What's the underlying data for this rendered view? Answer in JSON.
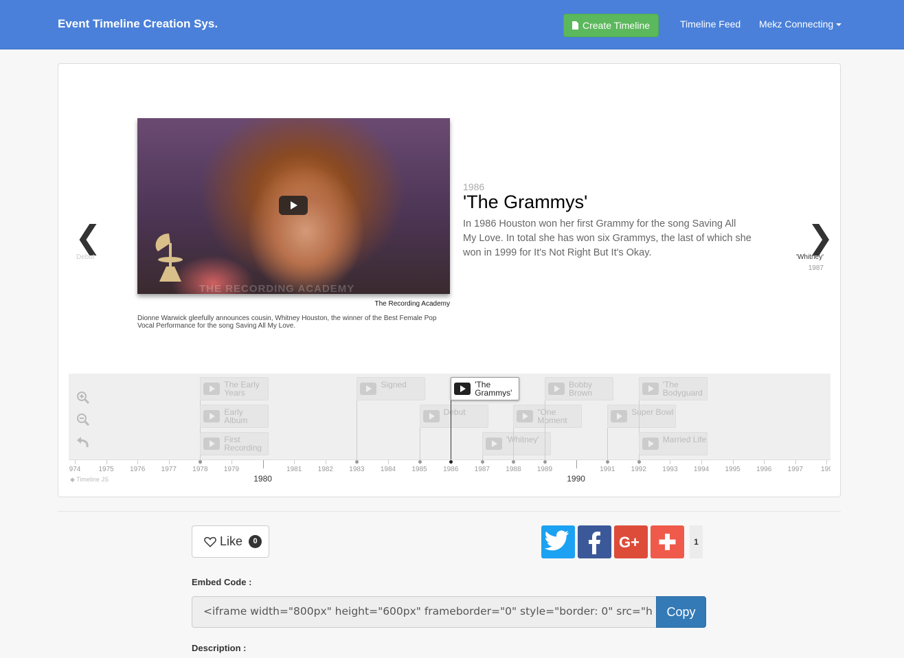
{
  "navbar": {
    "brand": "Event Timeline Creation Sys.",
    "create_label": "Create Timeline",
    "feed_label": "Timeline Feed",
    "user_label": "Mekz Connecting"
  },
  "slide": {
    "date": "1986",
    "title": "'The Grammys'",
    "text": "In 1986 Houston won her first Grammy for the song Saving All My Love. In total she has won six Grammys, the last of which she won in 1999 for It's Not Right But It's Okay.",
    "credit": "The Recording Academy",
    "caption": "Dionne Warwick gleefully announces cousin, Whitney Houston, the winner of the Best Female Pop Vocal Performance for the song Saving All My Love.",
    "watermark": "THE RECORDING ACADEMY"
  },
  "nav": {
    "prev_label": "Debut",
    "next_label": "'Whitney'",
    "next_date": "1987"
  },
  "timeline": {
    "markers": [
      {
        "label": "The Early Years",
        "year": 1978,
        "row": 0,
        "active": false
      },
      {
        "label": "Early Album",
        "year": 1978,
        "row": 1,
        "active": false
      },
      {
        "label": "First Recording",
        "year": 1978,
        "row": 2,
        "active": false
      },
      {
        "label": "Signed",
        "year": 1983,
        "row": 0,
        "active": false
      },
      {
        "label": "Debut",
        "year": 1985,
        "row": 1,
        "active": false
      },
      {
        "label": "'The Grammys'",
        "year": 1986,
        "row": 0,
        "active": true
      },
      {
        "label": "'Whitney'",
        "year": 1987,
        "row": 2,
        "active": false
      },
      {
        "label": "\"One Moment",
        "year": 1988,
        "row": 1,
        "active": false
      },
      {
        "label": "Bobby Brown",
        "year": 1989,
        "row": 0,
        "active": false
      },
      {
        "label": "Super Bowl",
        "year": 1991,
        "row": 1,
        "active": false
      },
      {
        "label": "'The Bodyguard",
        "year": 1992,
        "row": 0,
        "active": false
      },
      {
        "label": "Married Life",
        "year": 1992,
        "row": 2,
        "active": false
      }
    ],
    "years": [
      "974",
      "1975",
      "1976",
      "1977",
      "1978",
      "1979",
      "1980",
      "1981",
      "1982",
      "1983",
      "1984",
      "1985",
      "1986",
      "1987",
      "1988",
      "1989",
      "1990",
      "1991",
      "1992",
      "1993",
      "1994",
      "1995",
      "1996",
      "1997",
      "199"
    ],
    "major_years": [
      "1980",
      "1990"
    ],
    "brand": "Timeline JS",
    "tools": [
      "zoom-in-icon",
      "zoom-out-icon",
      "back-to-start-icon"
    ]
  },
  "like": {
    "label": "Like",
    "count": "0"
  },
  "share": {
    "count": "1",
    "buttons": [
      {
        "name": "twitter-share-button",
        "icon": "twitter-icon",
        "color": "#1da1f2"
      },
      {
        "name": "facebook-share-button",
        "icon": "facebook-icon",
        "color": "#3b5998"
      },
      {
        "name": "google-plus-share-button",
        "icon": "google-plus-icon",
        "color": "#dd4b39"
      },
      {
        "name": "more-share-button",
        "icon": "plus-icon",
        "color": "#ef5a4a"
      }
    ]
  },
  "embed": {
    "label": "Embed Code :",
    "value": "<iframe width=\"800px\" height=\"600px\" frameborder=\"0\" style=\"border: 0\" src=\"h",
    "copy_label": "Copy"
  },
  "description_label": "Description :"
}
